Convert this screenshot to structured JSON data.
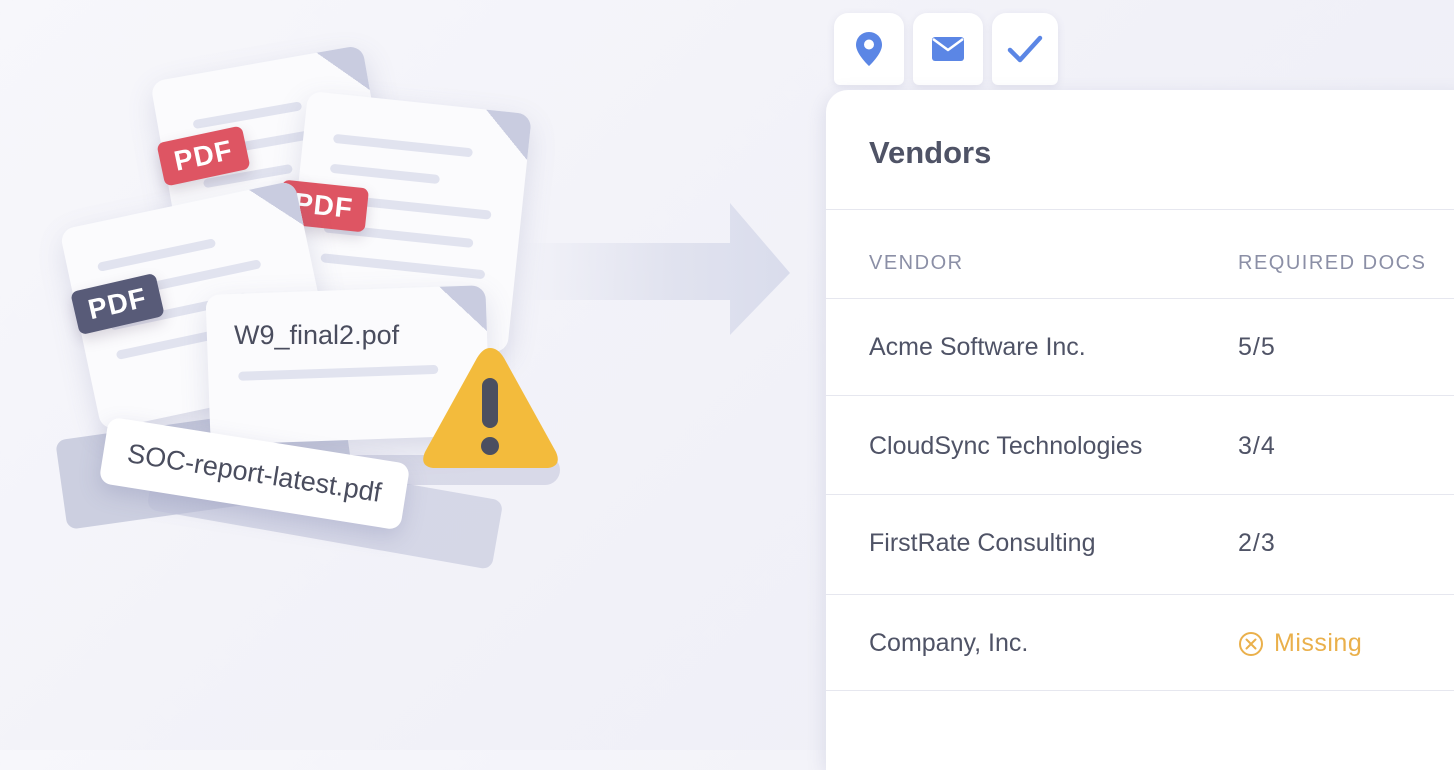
{
  "illustration": {
    "pdf_badges": [
      "PDF",
      "PDF",
      "PDF"
    ],
    "file_names": [
      "W9_final2.pof",
      "SOC-report-latest.pdf"
    ]
  },
  "toolbar": {
    "icons": [
      "location-pin-icon",
      "envelope-icon",
      "checkmark-icon"
    ],
    "accent": "#5b86e5"
  },
  "panel": {
    "title": "Vendors",
    "columns": [
      "VENDOR",
      "REQUIRED DOCS"
    ],
    "rows": [
      {
        "vendor": "Acme Software Inc.",
        "docs": "5/5"
      },
      {
        "vendor": "CloudSync Technologies",
        "docs": "3/4"
      },
      {
        "vendor": "FirstRate Consulting",
        "docs": "2/3"
      },
      {
        "vendor": "Company, Inc.",
        "docs": "Missing",
        "status_icon": "x-circle-icon",
        "status_color": "#eab04b"
      }
    ]
  },
  "colors": {
    "pdf_red": "#de5563",
    "pdf_slate": "#585b78",
    "warning": "#f3bb3c"
  }
}
